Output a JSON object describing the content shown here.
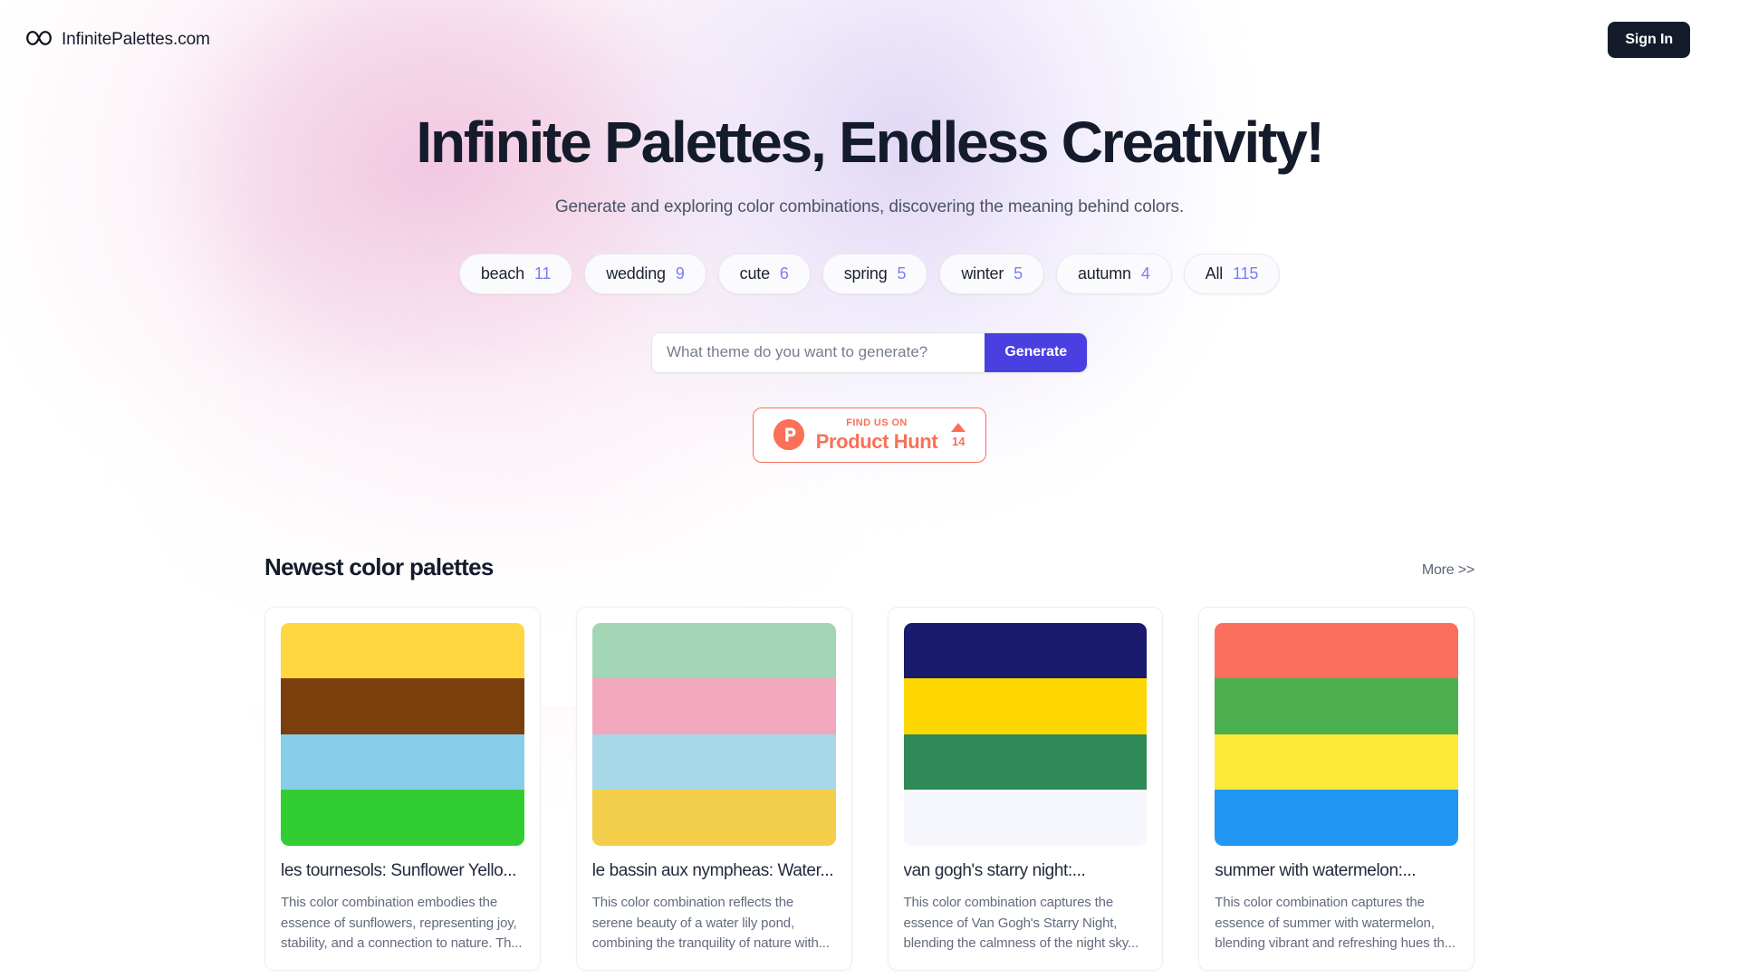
{
  "header": {
    "brand_name": "InfinitePalettes.com",
    "logo_icon": "infinity-icon",
    "signin_label": "Sign In"
  },
  "hero": {
    "title": "Infinite Palettes, Endless Creativity!",
    "subtitle": "Generate and exploring color combinations, discovering the meaning behind colors."
  },
  "chips": [
    {
      "label": "beach",
      "count": "11"
    },
    {
      "label": "wedding",
      "count": "9"
    },
    {
      "label": "cute",
      "count": "6"
    },
    {
      "label": "spring",
      "count": "5"
    },
    {
      "label": "winter",
      "count": "5"
    },
    {
      "label": "autumn",
      "count": "4"
    },
    {
      "label": "All",
      "count": "115"
    }
  ],
  "search": {
    "placeholder": "What theme do you want to generate?",
    "value": "",
    "generate_label": "Generate"
  },
  "product_hunt": {
    "small_text": "FIND US ON",
    "big_text": "Product Hunt",
    "vote_count": "14",
    "logo_letter": "P",
    "accent_color": "#fa7058"
  },
  "section": {
    "title": "Newest color palettes",
    "more_label": "More >>"
  },
  "cards": [
    {
      "title": "les tournesols: Sunflower Yello...",
      "description": "This color combination embodies the essence of sunflowers, representing joy, stability, and a connection to nature. Th...",
      "colors": [
        "#FFD740",
        "#7B3F0E",
        "#87CEEB",
        "#32CD32"
      ]
    },
    {
      "title": "le bassin aux nympheas: Water...",
      "description": "This color combination reflects the serene beauty of a water lily pond, combining the tranquility of nature with...",
      "colors": [
        "#A3D6B5",
        "#F2A8BC",
        "#A7D8E8",
        "#F2CE4B"
      ]
    },
    {
      "title": "van gogh's starry night:...",
      "description": "This color combination captures the essence of Van Gogh's Starry Night, blending the calmness of the night sky...",
      "colors": [
        "#1A1A6E",
        "#FFD700",
        "#2E8B57",
        "#F5F7FC"
      ]
    },
    {
      "title": "summer with watermelon:...",
      "description": "This color combination captures the essence of summer with watermelon, blending vibrant and refreshing hues th...",
      "colors": [
        "#FB6F5F",
        "#4CAF50",
        "#FCE938",
        "#2196F3"
      ]
    }
  ],
  "theme": {
    "accent_indigo": "#4a3fe0",
    "chip_count_color": "#7b7ef2",
    "dark": "#141b2b"
  }
}
